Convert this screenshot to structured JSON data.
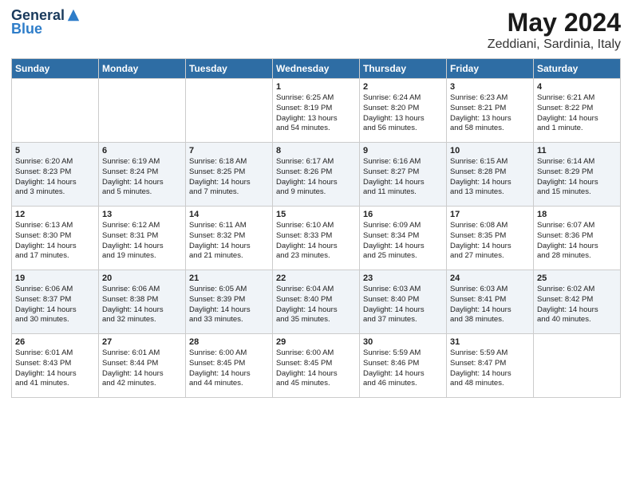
{
  "logo": {
    "general": "General",
    "blue": "Blue"
  },
  "title": "May 2024",
  "subtitle": "Zeddiani, Sardinia, Italy",
  "days_header": [
    "Sunday",
    "Monday",
    "Tuesday",
    "Wednesday",
    "Thursday",
    "Friday",
    "Saturday"
  ],
  "weeks": [
    [
      {
        "day": "",
        "text": ""
      },
      {
        "day": "",
        "text": ""
      },
      {
        "day": "",
        "text": ""
      },
      {
        "day": "1",
        "text": "Sunrise: 6:25 AM\nSunset: 8:19 PM\nDaylight: 13 hours\nand 54 minutes."
      },
      {
        "day": "2",
        "text": "Sunrise: 6:24 AM\nSunset: 8:20 PM\nDaylight: 13 hours\nand 56 minutes."
      },
      {
        "day": "3",
        "text": "Sunrise: 6:23 AM\nSunset: 8:21 PM\nDaylight: 13 hours\nand 58 minutes."
      },
      {
        "day": "4",
        "text": "Sunrise: 6:21 AM\nSunset: 8:22 PM\nDaylight: 14 hours\nand 1 minute."
      }
    ],
    [
      {
        "day": "5",
        "text": "Sunrise: 6:20 AM\nSunset: 8:23 PM\nDaylight: 14 hours\nand 3 minutes."
      },
      {
        "day": "6",
        "text": "Sunrise: 6:19 AM\nSunset: 8:24 PM\nDaylight: 14 hours\nand 5 minutes."
      },
      {
        "day": "7",
        "text": "Sunrise: 6:18 AM\nSunset: 8:25 PM\nDaylight: 14 hours\nand 7 minutes."
      },
      {
        "day": "8",
        "text": "Sunrise: 6:17 AM\nSunset: 8:26 PM\nDaylight: 14 hours\nand 9 minutes."
      },
      {
        "day": "9",
        "text": "Sunrise: 6:16 AM\nSunset: 8:27 PM\nDaylight: 14 hours\nand 11 minutes."
      },
      {
        "day": "10",
        "text": "Sunrise: 6:15 AM\nSunset: 8:28 PM\nDaylight: 14 hours\nand 13 minutes."
      },
      {
        "day": "11",
        "text": "Sunrise: 6:14 AM\nSunset: 8:29 PM\nDaylight: 14 hours\nand 15 minutes."
      }
    ],
    [
      {
        "day": "12",
        "text": "Sunrise: 6:13 AM\nSunset: 8:30 PM\nDaylight: 14 hours\nand 17 minutes."
      },
      {
        "day": "13",
        "text": "Sunrise: 6:12 AM\nSunset: 8:31 PM\nDaylight: 14 hours\nand 19 minutes."
      },
      {
        "day": "14",
        "text": "Sunrise: 6:11 AM\nSunset: 8:32 PM\nDaylight: 14 hours\nand 21 minutes."
      },
      {
        "day": "15",
        "text": "Sunrise: 6:10 AM\nSunset: 8:33 PM\nDaylight: 14 hours\nand 23 minutes."
      },
      {
        "day": "16",
        "text": "Sunrise: 6:09 AM\nSunset: 8:34 PM\nDaylight: 14 hours\nand 25 minutes."
      },
      {
        "day": "17",
        "text": "Sunrise: 6:08 AM\nSunset: 8:35 PM\nDaylight: 14 hours\nand 27 minutes."
      },
      {
        "day": "18",
        "text": "Sunrise: 6:07 AM\nSunset: 8:36 PM\nDaylight: 14 hours\nand 28 minutes."
      }
    ],
    [
      {
        "day": "19",
        "text": "Sunrise: 6:06 AM\nSunset: 8:37 PM\nDaylight: 14 hours\nand 30 minutes."
      },
      {
        "day": "20",
        "text": "Sunrise: 6:06 AM\nSunset: 8:38 PM\nDaylight: 14 hours\nand 32 minutes."
      },
      {
        "day": "21",
        "text": "Sunrise: 6:05 AM\nSunset: 8:39 PM\nDaylight: 14 hours\nand 33 minutes."
      },
      {
        "day": "22",
        "text": "Sunrise: 6:04 AM\nSunset: 8:40 PM\nDaylight: 14 hours\nand 35 minutes."
      },
      {
        "day": "23",
        "text": "Sunrise: 6:03 AM\nSunset: 8:40 PM\nDaylight: 14 hours\nand 37 minutes."
      },
      {
        "day": "24",
        "text": "Sunrise: 6:03 AM\nSunset: 8:41 PM\nDaylight: 14 hours\nand 38 minutes."
      },
      {
        "day": "25",
        "text": "Sunrise: 6:02 AM\nSunset: 8:42 PM\nDaylight: 14 hours\nand 40 minutes."
      }
    ],
    [
      {
        "day": "26",
        "text": "Sunrise: 6:01 AM\nSunset: 8:43 PM\nDaylight: 14 hours\nand 41 minutes."
      },
      {
        "day": "27",
        "text": "Sunrise: 6:01 AM\nSunset: 8:44 PM\nDaylight: 14 hours\nand 42 minutes."
      },
      {
        "day": "28",
        "text": "Sunrise: 6:00 AM\nSunset: 8:45 PM\nDaylight: 14 hours\nand 44 minutes."
      },
      {
        "day": "29",
        "text": "Sunrise: 6:00 AM\nSunset: 8:45 PM\nDaylight: 14 hours\nand 45 minutes."
      },
      {
        "day": "30",
        "text": "Sunrise: 5:59 AM\nSunset: 8:46 PM\nDaylight: 14 hours\nand 46 minutes."
      },
      {
        "day": "31",
        "text": "Sunrise: 5:59 AM\nSunset: 8:47 PM\nDaylight: 14 hours\nand 48 minutes."
      },
      {
        "day": "",
        "text": ""
      }
    ]
  ]
}
